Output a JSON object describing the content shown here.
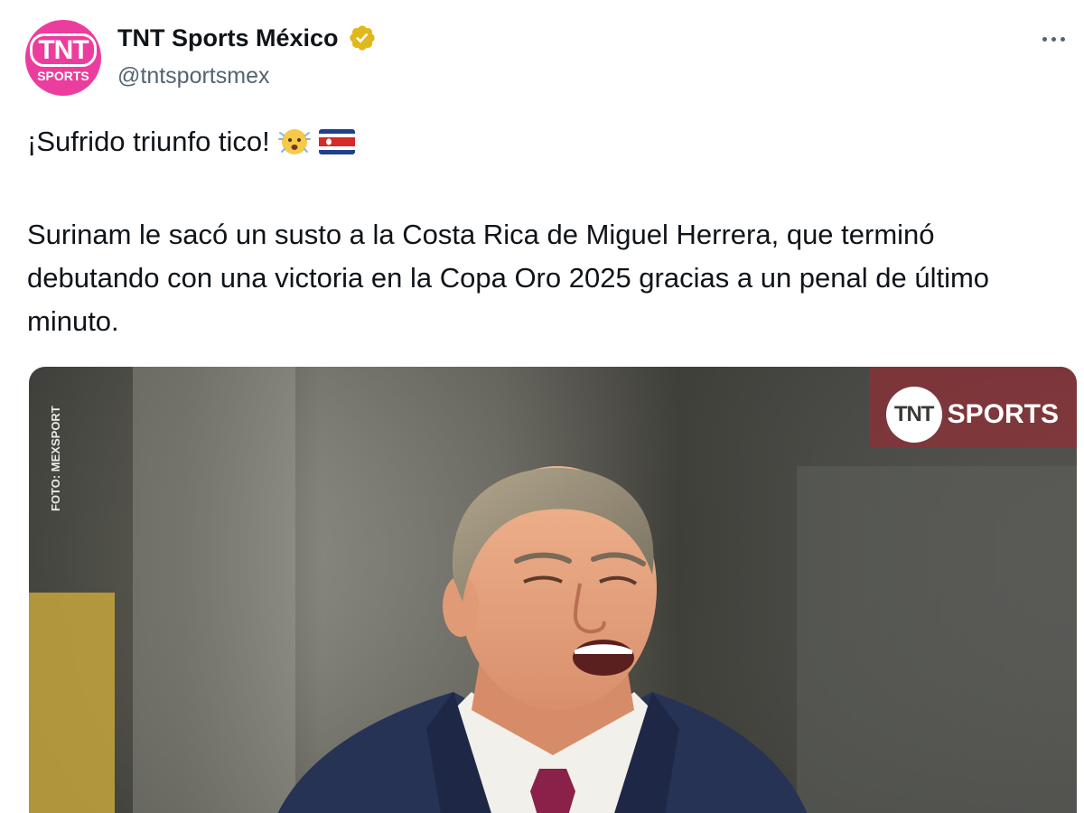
{
  "author": {
    "display_name": "TNT Sports México",
    "handle": "@tntsportsmex",
    "avatar_top": "TNT",
    "avatar_bottom": "SPORTS"
  },
  "tweet": {
    "headline": "¡Sufrido triunfo tico!",
    "body": "Surinam le sacó un susto a la Costa Rica de Miguel Herrera, que terminó debutando con una victoria en la Copa Oro 2025 gracias a un penal de último minuto."
  },
  "media": {
    "photo_credit": "FOTO: MEXSPORT",
    "brand_circle": "TNT",
    "brand_text": "SPORTS"
  },
  "icons": {
    "verified": "verified-badge-icon",
    "more": "more-options-icon",
    "face": "anxious-face-emoji-icon",
    "flag": "costa-rica-flag-icon"
  },
  "colors": {
    "avatar_bg": "#ec3d9e",
    "verified_gold": "#e2b719",
    "handle_gray": "#536471",
    "text": "#0f1419"
  }
}
